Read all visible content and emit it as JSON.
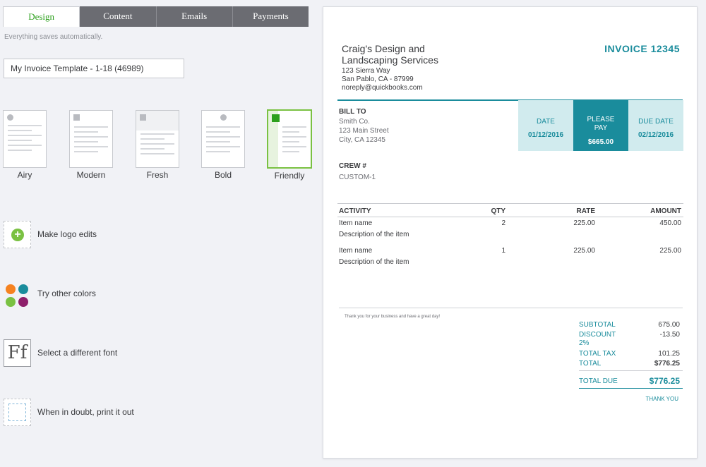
{
  "tabs": [
    {
      "label": "Design",
      "active": true
    },
    {
      "label": "Content",
      "active": false
    },
    {
      "label": "Emails",
      "active": false
    },
    {
      "label": "Payments",
      "active": false
    }
  ],
  "autosave_text": "Everything saves automatically.",
  "template_name": "My Invoice Template - 1-18 (46989)",
  "styles": [
    {
      "label": "Airy"
    },
    {
      "label": "Modern"
    },
    {
      "label": "Fresh"
    },
    {
      "label": "Bold"
    },
    {
      "label": "Friendly",
      "selected": true
    }
  ],
  "actions": [
    {
      "label": "Make logo edits",
      "icon": "plus-circle-icon"
    },
    {
      "label": "Try other colors",
      "icon": "color-palette-icon"
    },
    {
      "label": "Select a different font",
      "icon": "font-icon"
    },
    {
      "label": "When in doubt, print it out",
      "icon": "print-preview-icon"
    }
  ],
  "palette_colors": [
    "#f58220",
    "#1a8c9c",
    "#7ac142",
    "#8e1f6b"
  ],
  "accent_color": "#1a8c9c",
  "brand_green": "#2ca01c",
  "invoice": {
    "company_name": "Craig's Design and Landscaping Services",
    "company_address1": "123 Sierra Way",
    "company_address2": "San Pablo, CA - 87999",
    "company_email": "noreply@quickbooks.com",
    "title": "INVOICE 12345",
    "bill_to_label": "BILL TO",
    "bill_to_name": "Smith Co.",
    "bill_to_street": "123 Main Street",
    "bill_to_city": "City, CA 12345",
    "date_label": "DATE",
    "date_value": "01/12/2016",
    "please_pay_label1": "PLEASE",
    "please_pay_label2": "PAY",
    "please_pay_value": "$665.00",
    "due_date_label": "DUE DATE",
    "due_date_value": "02/12/2016",
    "crew_label": "CREW #",
    "crew_value": "CUSTOM-1",
    "columns": {
      "activity": "ACTIVITY",
      "qty": "QTY",
      "rate": "RATE",
      "amount": "AMOUNT"
    },
    "items": [
      {
        "name": "Item name",
        "description": "Description of the item",
        "qty": "2",
        "rate": "225.00",
        "amount": "450.00"
      },
      {
        "name": "Item name",
        "description": "Description of the item",
        "qty": "1",
        "rate": "225.00",
        "amount": "225.00"
      }
    ],
    "note": "Thank you for your business and have a great day!",
    "subtotal_label": "SUBTOTAL",
    "subtotal_value": "675.00",
    "discount_label1": "DISCOUNT",
    "discount_label2": "2%",
    "discount_value": "-13.50",
    "tax_label": "TOTAL TAX",
    "tax_value": "101.25",
    "total_label": "TOTAL",
    "total_value": "$776.25",
    "total_due_label": "TOTAL DUE",
    "total_due_value": "$776.25",
    "thank_you": "THANK YOU"
  }
}
